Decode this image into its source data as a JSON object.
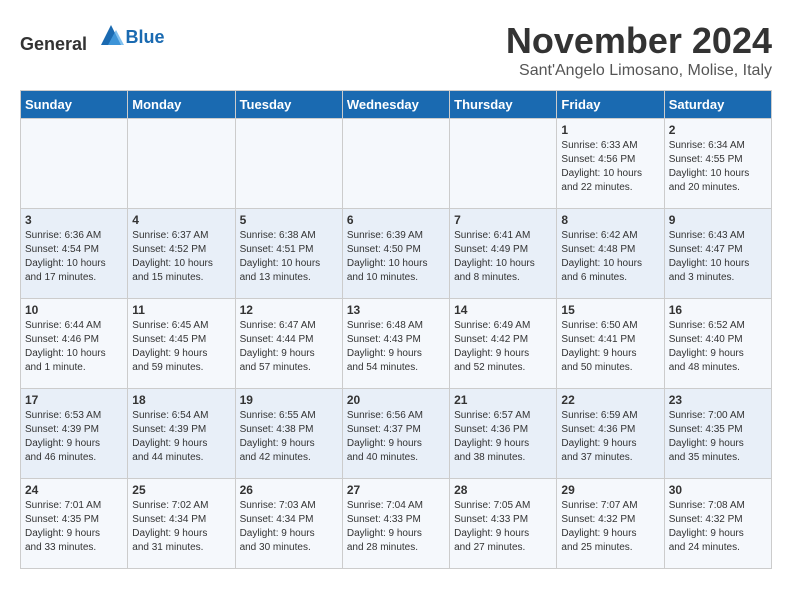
{
  "header": {
    "logo_general": "General",
    "logo_blue": "Blue",
    "month_title": "November 2024",
    "location": "Sant'Angelo Limosano, Molise, Italy"
  },
  "days_of_week": [
    "Sunday",
    "Monday",
    "Tuesday",
    "Wednesday",
    "Thursday",
    "Friday",
    "Saturday"
  ],
  "weeks": [
    [
      {
        "day": "",
        "info": ""
      },
      {
        "day": "",
        "info": ""
      },
      {
        "day": "",
        "info": ""
      },
      {
        "day": "",
        "info": ""
      },
      {
        "day": "",
        "info": ""
      },
      {
        "day": "1",
        "info": "Sunrise: 6:33 AM\nSunset: 4:56 PM\nDaylight: 10 hours\nand 22 minutes."
      },
      {
        "day": "2",
        "info": "Sunrise: 6:34 AM\nSunset: 4:55 PM\nDaylight: 10 hours\nand 20 minutes."
      }
    ],
    [
      {
        "day": "3",
        "info": "Sunrise: 6:36 AM\nSunset: 4:54 PM\nDaylight: 10 hours\nand 17 minutes."
      },
      {
        "day": "4",
        "info": "Sunrise: 6:37 AM\nSunset: 4:52 PM\nDaylight: 10 hours\nand 15 minutes."
      },
      {
        "day": "5",
        "info": "Sunrise: 6:38 AM\nSunset: 4:51 PM\nDaylight: 10 hours\nand 13 minutes."
      },
      {
        "day": "6",
        "info": "Sunrise: 6:39 AM\nSunset: 4:50 PM\nDaylight: 10 hours\nand 10 minutes."
      },
      {
        "day": "7",
        "info": "Sunrise: 6:41 AM\nSunset: 4:49 PM\nDaylight: 10 hours\nand 8 minutes."
      },
      {
        "day": "8",
        "info": "Sunrise: 6:42 AM\nSunset: 4:48 PM\nDaylight: 10 hours\nand 6 minutes."
      },
      {
        "day": "9",
        "info": "Sunrise: 6:43 AM\nSunset: 4:47 PM\nDaylight: 10 hours\nand 3 minutes."
      }
    ],
    [
      {
        "day": "10",
        "info": "Sunrise: 6:44 AM\nSunset: 4:46 PM\nDaylight: 10 hours\nand 1 minute."
      },
      {
        "day": "11",
        "info": "Sunrise: 6:45 AM\nSunset: 4:45 PM\nDaylight: 9 hours\nand 59 minutes."
      },
      {
        "day": "12",
        "info": "Sunrise: 6:47 AM\nSunset: 4:44 PM\nDaylight: 9 hours\nand 57 minutes."
      },
      {
        "day": "13",
        "info": "Sunrise: 6:48 AM\nSunset: 4:43 PM\nDaylight: 9 hours\nand 54 minutes."
      },
      {
        "day": "14",
        "info": "Sunrise: 6:49 AM\nSunset: 4:42 PM\nDaylight: 9 hours\nand 52 minutes."
      },
      {
        "day": "15",
        "info": "Sunrise: 6:50 AM\nSunset: 4:41 PM\nDaylight: 9 hours\nand 50 minutes."
      },
      {
        "day": "16",
        "info": "Sunrise: 6:52 AM\nSunset: 4:40 PM\nDaylight: 9 hours\nand 48 minutes."
      }
    ],
    [
      {
        "day": "17",
        "info": "Sunrise: 6:53 AM\nSunset: 4:39 PM\nDaylight: 9 hours\nand 46 minutes."
      },
      {
        "day": "18",
        "info": "Sunrise: 6:54 AM\nSunset: 4:39 PM\nDaylight: 9 hours\nand 44 minutes."
      },
      {
        "day": "19",
        "info": "Sunrise: 6:55 AM\nSunset: 4:38 PM\nDaylight: 9 hours\nand 42 minutes."
      },
      {
        "day": "20",
        "info": "Sunrise: 6:56 AM\nSunset: 4:37 PM\nDaylight: 9 hours\nand 40 minutes."
      },
      {
        "day": "21",
        "info": "Sunrise: 6:57 AM\nSunset: 4:36 PM\nDaylight: 9 hours\nand 38 minutes."
      },
      {
        "day": "22",
        "info": "Sunrise: 6:59 AM\nSunset: 4:36 PM\nDaylight: 9 hours\nand 37 minutes."
      },
      {
        "day": "23",
        "info": "Sunrise: 7:00 AM\nSunset: 4:35 PM\nDaylight: 9 hours\nand 35 minutes."
      }
    ],
    [
      {
        "day": "24",
        "info": "Sunrise: 7:01 AM\nSunset: 4:35 PM\nDaylight: 9 hours\nand 33 minutes."
      },
      {
        "day": "25",
        "info": "Sunrise: 7:02 AM\nSunset: 4:34 PM\nDaylight: 9 hours\nand 31 minutes."
      },
      {
        "day": "26",
        "info": "Sunrise: 7:03 AM\nSunset: 4:34 PM\nDaylight: 9 hours\nand 30 minutes."
      },
      {
        "day": "27",
        "info": "Sunrise: 7:04 AM\nSunset: 4:33 PM\nDaylight: 9 hours\nand 28 minutes."
      },
      {
        "day": "28",
        "info": "Sunrise: 7:05 AM\nSunset: 4:33 PM\nDaylight: 9 hours\nand 27 minutes."
      },
      {
        "day": "29",
        "info": "Sunrise: 7:07 AM\nSunset: 4:32 PM\nDaylight: 9 hours\nand 25 minutes."
      },
      {
        "day": "30",
        "info": "Sunrise: 7:08 AM\nSunset: 4:32 PM\nDaylight: 9 hours\nand 24 minutes."
      }
    ]
  ]
}
